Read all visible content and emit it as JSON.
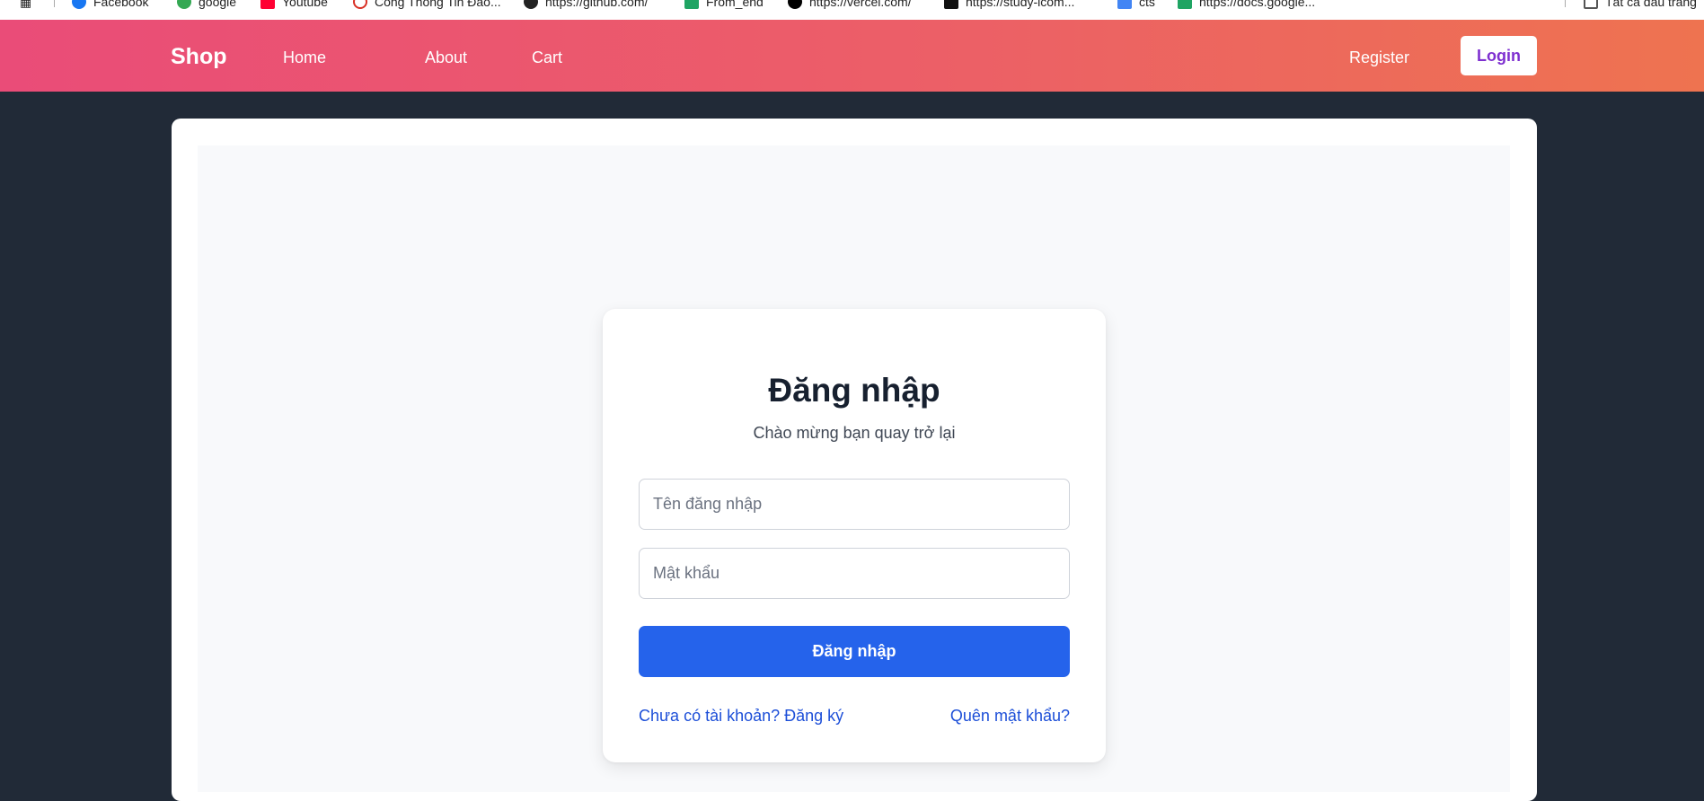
{
  "browser": {
    "bookmarks": [
      {
        "label": "Facebook",
        "icon": "facebook-icon",
        "color": "#1877f2"
      },
      {
        "label": "google",
        "icon": "google-icon",
        "color": "#34a853"
      },
      {
        "label": "Youtube",
        "icon": "youtube-icon",
        "color": "#ff0033"
      },
      {
        "label": "Cổng Thông Tin Đào...",
        "icon": "portal-icon",
        "color": "#d93025"
      },
      {
        "label": "https://github.com/",
        "icon": "github-icon",
        "color": "#222222"
      },
      {
        "label": "From_end",
        "icon": "sheets-icon",
        "color": "#1fa463"
      },
      {
        "label": "https://vercel.com/",
        "icon": "vercel-icon",
        "color": "#000000"
      },
      {
        "label": "https://study-icom...",
        "icon": "study-icon",
        "color": "#111111"
      },
      {
        "label": "cts",
        "icon": "cts-icon",
        "color": "#4285f4"
      },
      {
        "label": "https://docs.google...",
        "icon": "sheets-icon",
        "color": "#1fa463"
      },
      {
        "label": "Tất cả dấu trang",
        "icon": "folder-icon",
        "color": "#555555"
      }
    ]
  },
  "navbar": {
    "brand": "Shop",
    "links": [
      "Home",
      "About",
      "Cart"
    ],
    "register": "Register",
    "login": "Login"
  },
  "login_card": {
    "title": "Đăng nhập",
    "subtitle": "Chào mừng bạn quay trở lại",
    "username_placeholder": "Tên đăng nhập",
    "password_placeholder": "Mật khẩu",
    "submit_label": "Đăng nhập",
    "register_link": "Chưa có tài khoản? Đăng ký",
    "forgot_link": "Quên mật khẩu?"
  },
  "colors": {
    "page_background": "#212a37",
    "navbar_gradient_start": "#ea4c78",
    "navbar_gradient_end": "#ee7350",
    "primary_button": "#2563eb",
    "link": "#1d4fd8",
    "login_button_text": "#7e2fd0"
  }
}
